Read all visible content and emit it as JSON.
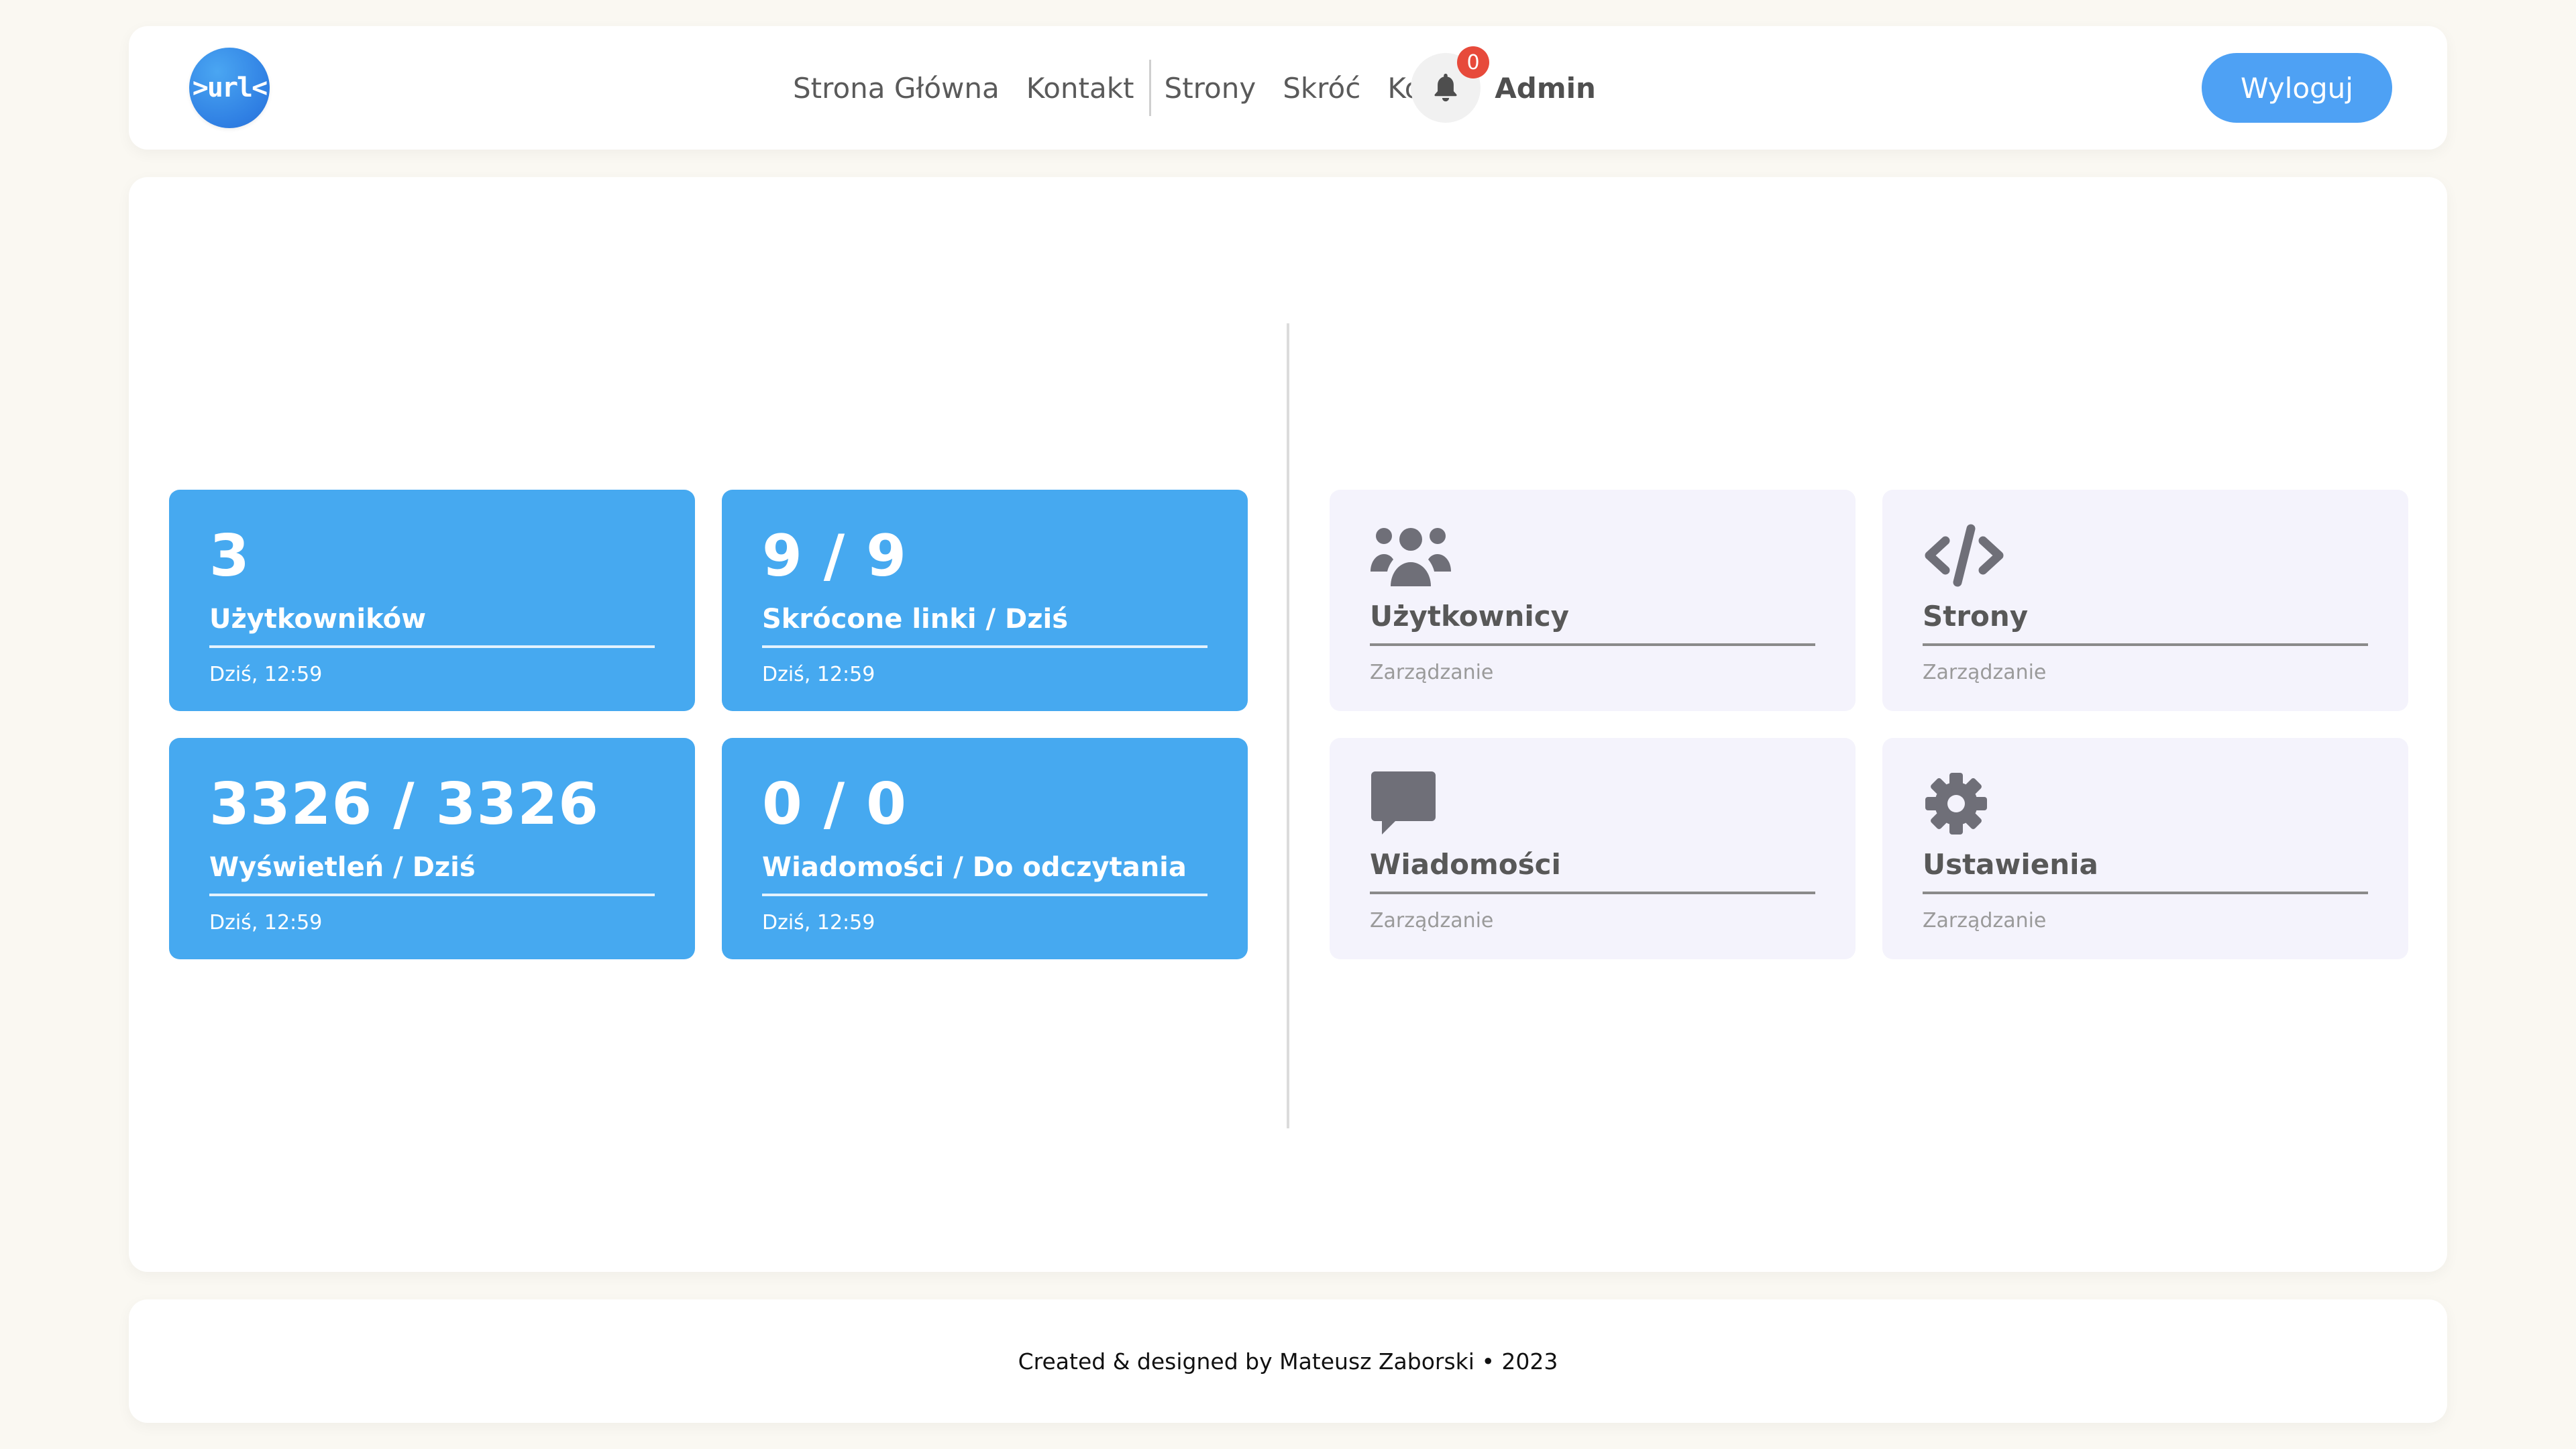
{
  "header": {
    "logo_text": ">url<",
    "nav": [
      "Strona Główna",
      "Kontakt",
      "Strony",
      "Skróć",
      "Konto",
      "Admin"
    ],
    "notification_count": "0",
    "logout_label": "Wyloguj"
  },
  "stats": [
    {
      "value": "3",
      "label": "Użytkowników",
      "time": "Dziś, 12:59"
    },
    {
      "value": "9 / 9",
      "label": "Skrócone linki / Dziś",
      "time": "Dziś, 12:59"
    },
    {
      "value": "3326 / 3326",
      "label": "Wyświetleń / Dziś",
      "time": "Dziś, 12:59"
    },
    {
      "value": "0 / 0",
      "label": "Wiadomości / Do odczytania",
      "time": "Dziś, 12:59"
    }
  ],
  "management": [
    {
      "icon": "users-icon",
      "title": "Użytkownicy",
      "subtitle": "Zarządzanie"
    },
    {
      "icon": "code-icon",
      "title": "Strony",
      "subtitle": "Zarządzanie"
    },
    {
      "icon": "message-icon",
      "title": "Wiadomości",
      "subtitle": "Zarządzanie"
    },
    {
      "icon": "gear-icon",
      "title": "Ustawienia",
      "subtitle": "Zarządzanie"
    }
  ],
  "footer": {
    "text": "Created & designed by Mateusz Zaborski • 2023"
  },
  "colors": {
    "accent": "#46a9f0",
    "button": "#4ea1f4",
    "badge": "#e74a3b",
    "mgmt_bg": "#f4f3fc",
    "icon": "#6f6f78"
  }
}
